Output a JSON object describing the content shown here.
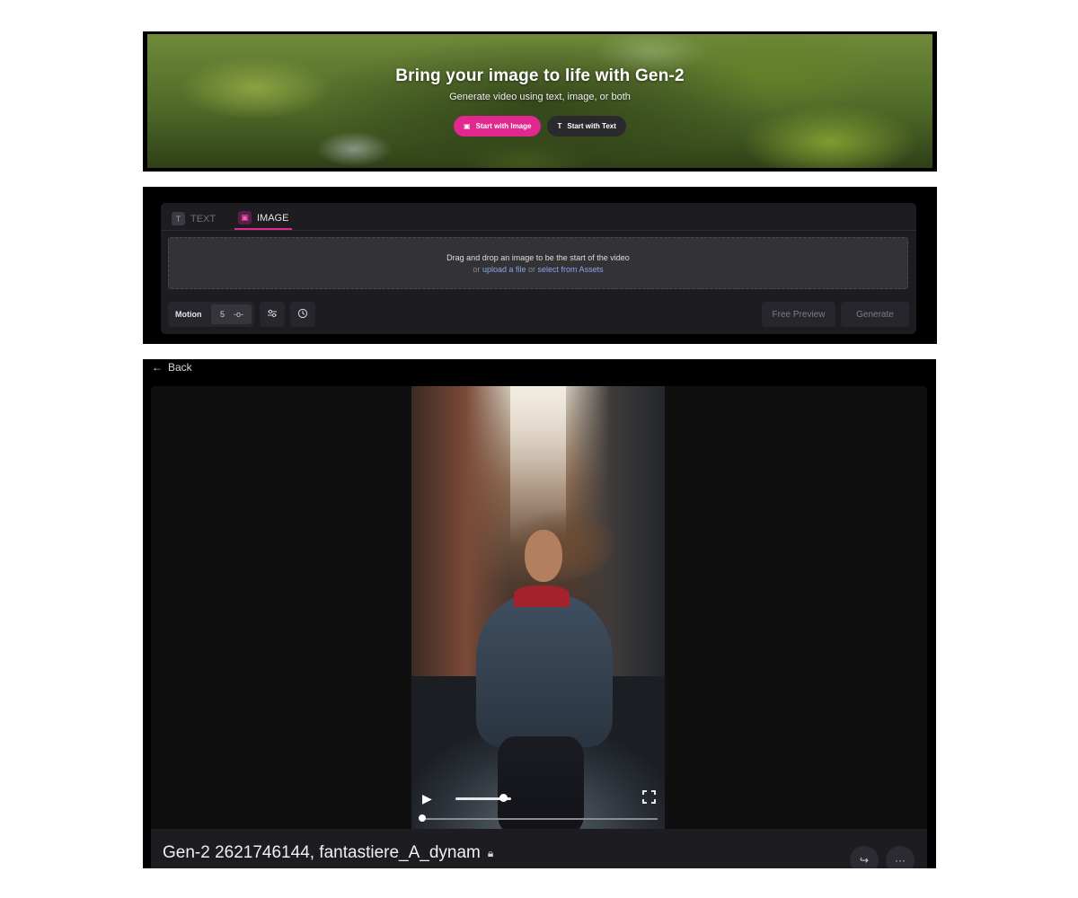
{
  "hero": {
    "title": "Bring your image to life with Gen-2",
    "subtitle": "Generate video using text, image, or both",
    "start_image_label": "Start with Image",
    "start_text_label": "Start with Text",
    "image_icon": "image-icon",
    "text_icon": "text-icon"
  },
  "editor": {
    "tabs": [
      {
        "label": "TEXT",
        "icon": "T",
        "active": false
      },
      {
        "label": "IMAGE",
        "icon": "▣",
        "active": true
      }
    ],
    "dropzone": {
      "line1": "Drag and drop an image to be the start of the video",
      "or1": "or",
      "upload_link": "upload a file",
      "or2": "or",
      "assets_link": "select from Assets"
    },
    "motion_label": "Motion",
    "motion_value": "5",
    "free_preview_label": "Free Preview",
    "generate_label": "Generate",
    "colors": {
      "accent": "#e0288f",
      "link": "#8da2f0"
    }
  },
  "viewer": {
    "back_label": "Back",
    "video_title": "Gen-2 2621746144, fantastiere_A_dynam",
    "volume_level": 0.85,
    "playback_progress": 0.0
  }
}
